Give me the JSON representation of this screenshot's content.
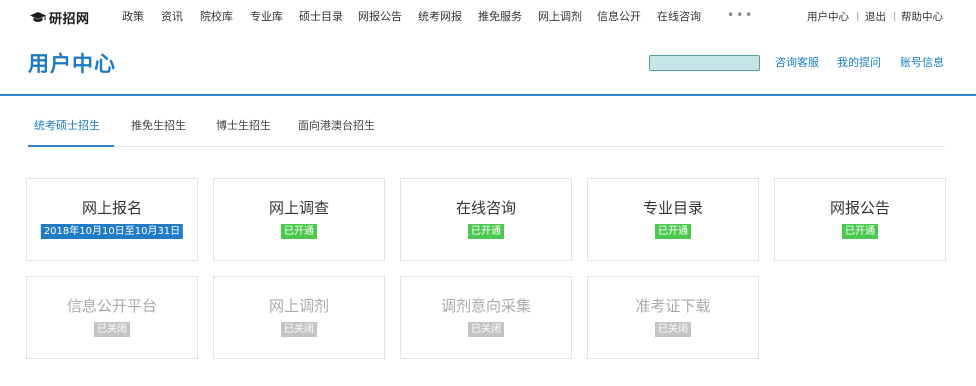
{
  "logo": {
    "text": "研招网"
  },
  "nav": {
    "items": [
      "政策",
      "资讯",
      "院校库",
      "专业库",
      "硕士目录",
      "网报公告",
      "统考网报",
      "推免服务",
      "网上调剂",
      "信息公开",
      "在线咨询"
    ],
    "more": "•••",
    "user_center": "用户中心",
    "logout": "退出",
    "help": "帮助中心",
    "separator": "|"
  },
  "header": {
    "title": "用户中心",
    "links": [
      "咨询客服",
      "我的提问",
      "账号信息"
    ],
    "colors": {
      "accent": "#1a7bc4",
      "search_fill": "#c7e4e6"
    }
  },
  "tabs": [
    "统考硕士招生",
    "推免生招生",
    "博士生招生",
    "面向港澳台招生"
  ],
  "cards": [
    {
      "title": "网上报名",
      "badge": "2018年10月10日至10月31日",
      "status": "date"
    },
    {
      "title": "网上调查",
      "badge": "已开通",
      "status": "open"
    },
    {
      "title": "在线咨询",
      "badge": "已开通",
      "status": "open"
    },
    {
      "title": "专业目录",
      "badge": "已开通",
      "status": "open"
    },
    {
      "title": "网报公告",
      "badge": "已开通",
      "status": "open"
    },
    {
      "title": "信息公开平台",
      "badge": "已关闭",
      "status": "closed"
    },
    {
      "title": "网上调剂",
      "badge": "已关闭",
      "status": "closed"
    },
    {
      "title": "调剂意向采集",
      "badge": "已关闭",
      "status": "closed"
    },
    {
      "title": "准考证下载",
      "badge": "已关闭",
      "status": "closed"
    }
  ]
}
